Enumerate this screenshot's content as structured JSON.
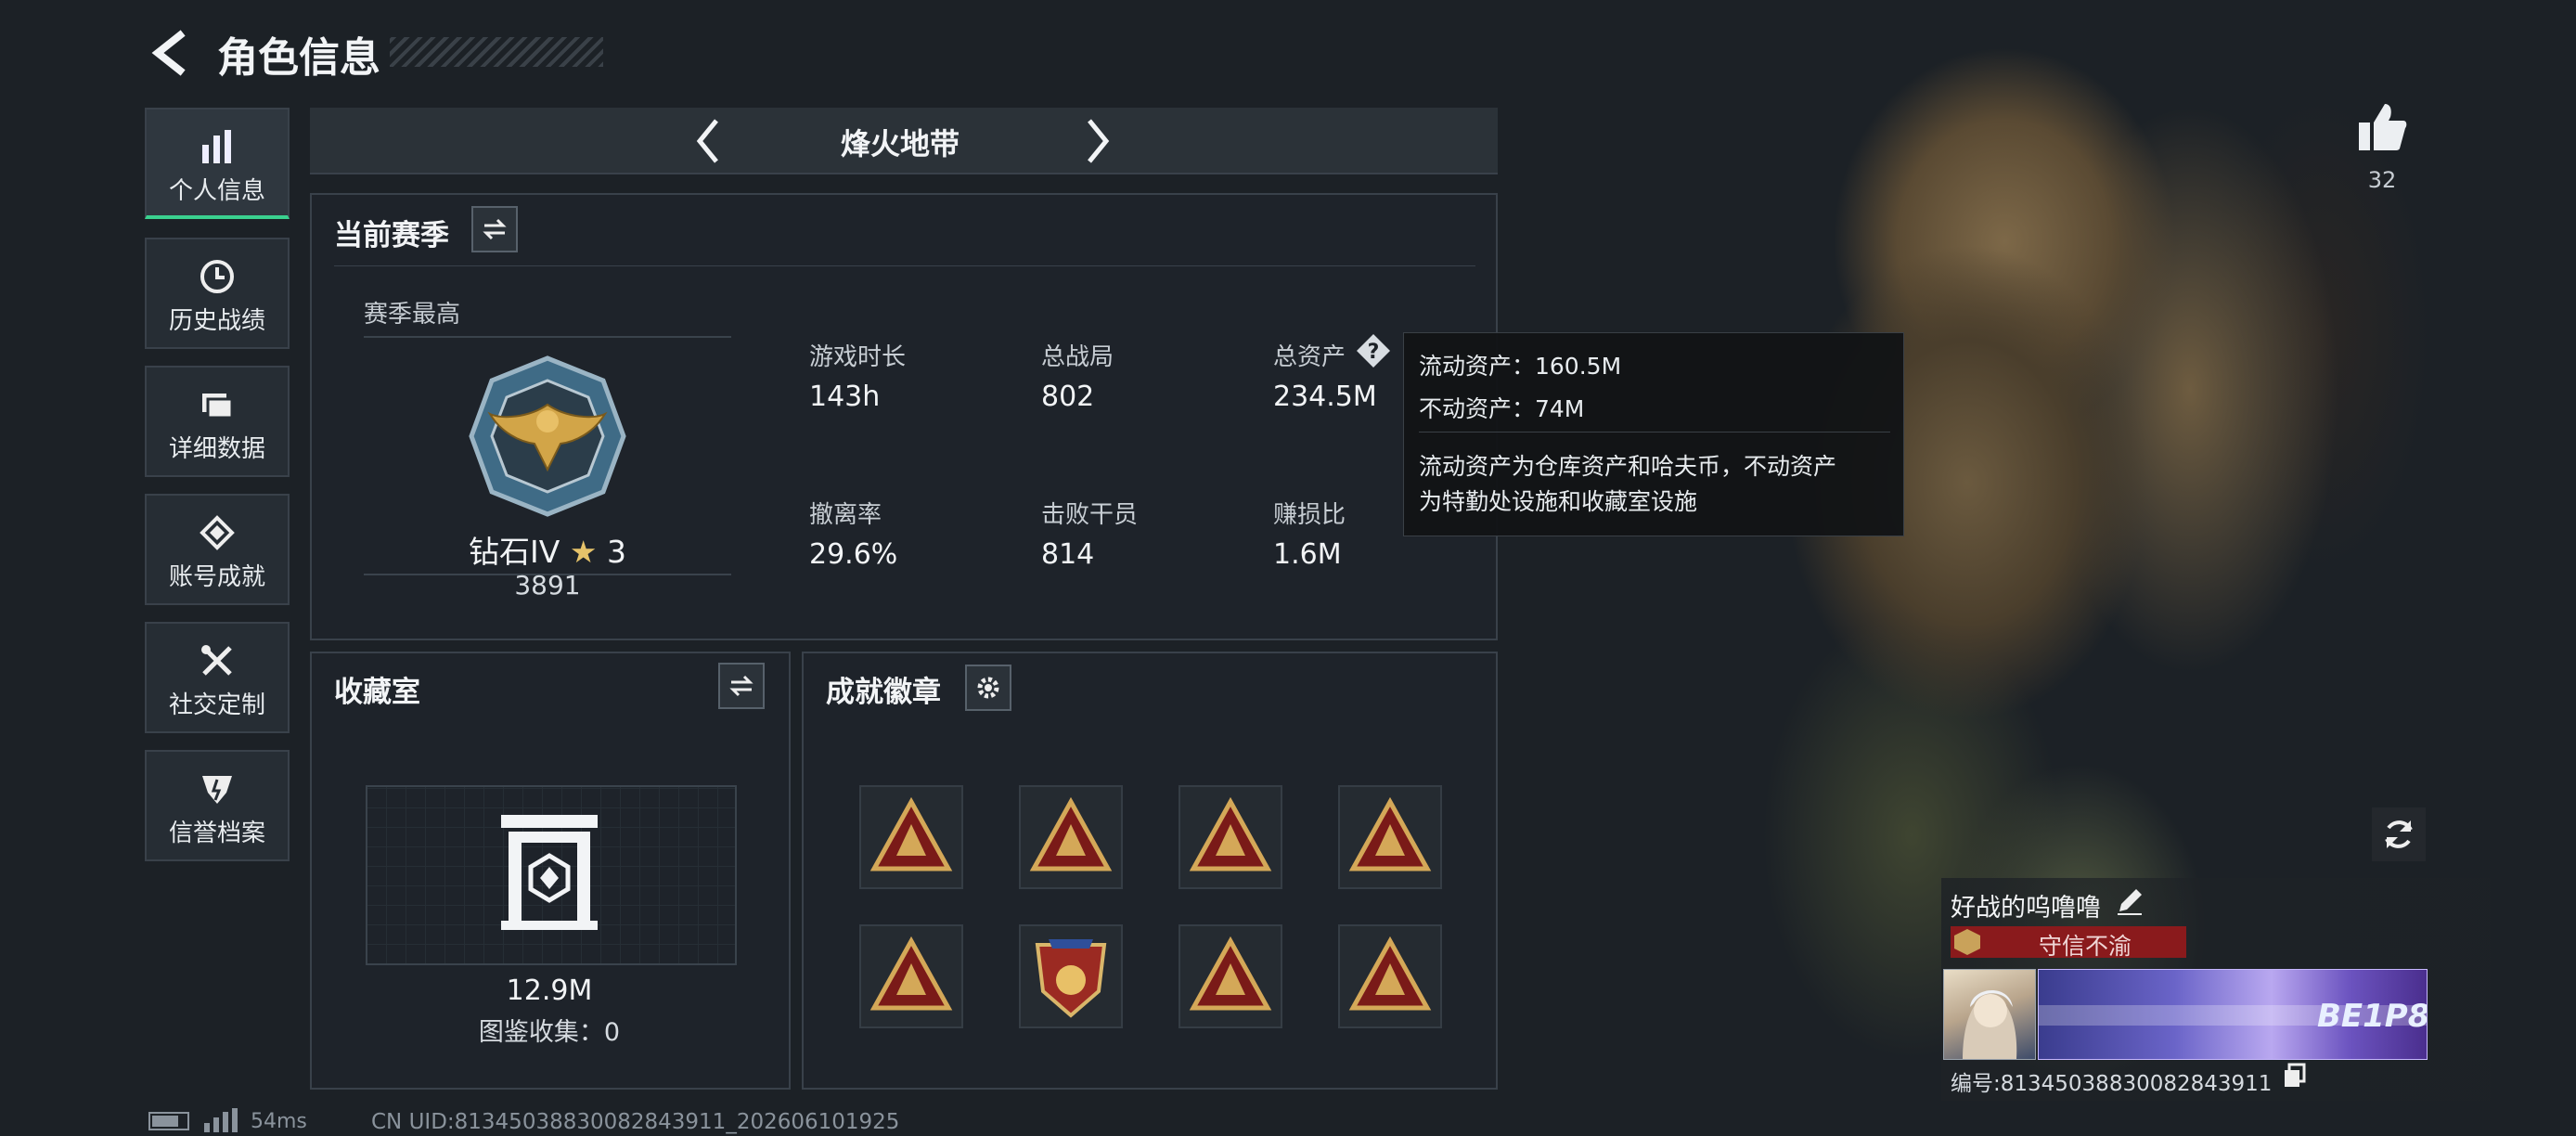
{
  "header": {
    "title": "角色信息"
  },
  "sidebar": {
    "items": [
      {
        "label": "个人信息",
        "icon": "bar-chart-icon",
        "active": true
      },
      {
        "label": "历史战绩",
        "icon": "clock-icon",
        "active": false
      },
      {
        "label": "详细数据",
        "icon": "folder-icon",
        "active": false
      },
      {
        "label": "账号成就",
        "icon": "medal-icon",
        "active": false
      },
      {
        "label": "社交定制",
        "icon": "tools-icon",
        "active": false
      },
      {
        "label": "信誉档案",
        "icon": "shield-icon",
        "active": false
      }
    ]
  },
  "mode_selector": {
    "label": "烽火地带"
  },
  "season": {
    "title": "当前赛季",
    "best_label": "赛季最高",
    "rank_name": "钻石IV",
    "rank_stars": "3",
    "rank_score": "3891",
    "stats": [
      {
        "label": "游戏时长",
        "value": "143h"
      },
      {
        "label": "总战局",
        "value": "802"
      },
      {
        "label": "总资产",
        "value": "234.5M"
      },
      {
        "label": "撤离率",
        "value": "29.6%"
      },
      {
        "label": "击败干员",
        "value": "814"
      },
      {
        "label": "赚损比",
        "value": "1.6M"
      }
    ]
  },
  "tooltip": {
    "line1": "流动资产：160.5M",
    "line2": "不动资产：74M",
    "desc1": "流动资产为仓库资产和哈夫币，不动资产",
    "desc2": "为特勤处设施和收藏室设施"
  },
  "collection": {
    "title": "收藏室",
    "value": "12.9M",
    "count_text": "图鉴收集：0"
  },
  "achievements": {
    "title": "成就徽章",
    "badges": [
      "badge-1",
      "badge-2",
      "badge-3",
      "badge-4",
      "badge-5",
      "badge-6",
      "badge-7",
      "badge-8"
    ]
  },
  "profile": {
    "likes": "32",
    "nickname": "好战的呜噜噜",
    "reputation": "守信不渝",
    "card_text": "BE1P8",
    "id_text": "编号:81345038830082843911"
  },
  "status_bar": {
    "ping": "54ms",
    "uid": "CN UID:81345038830082843911_202606101925"
  },
  "colors": {
    "accent": "#3ad18f",
    "badge_red": "#8a1a1c",
    "gold": "#c9a25a"
  }
}
